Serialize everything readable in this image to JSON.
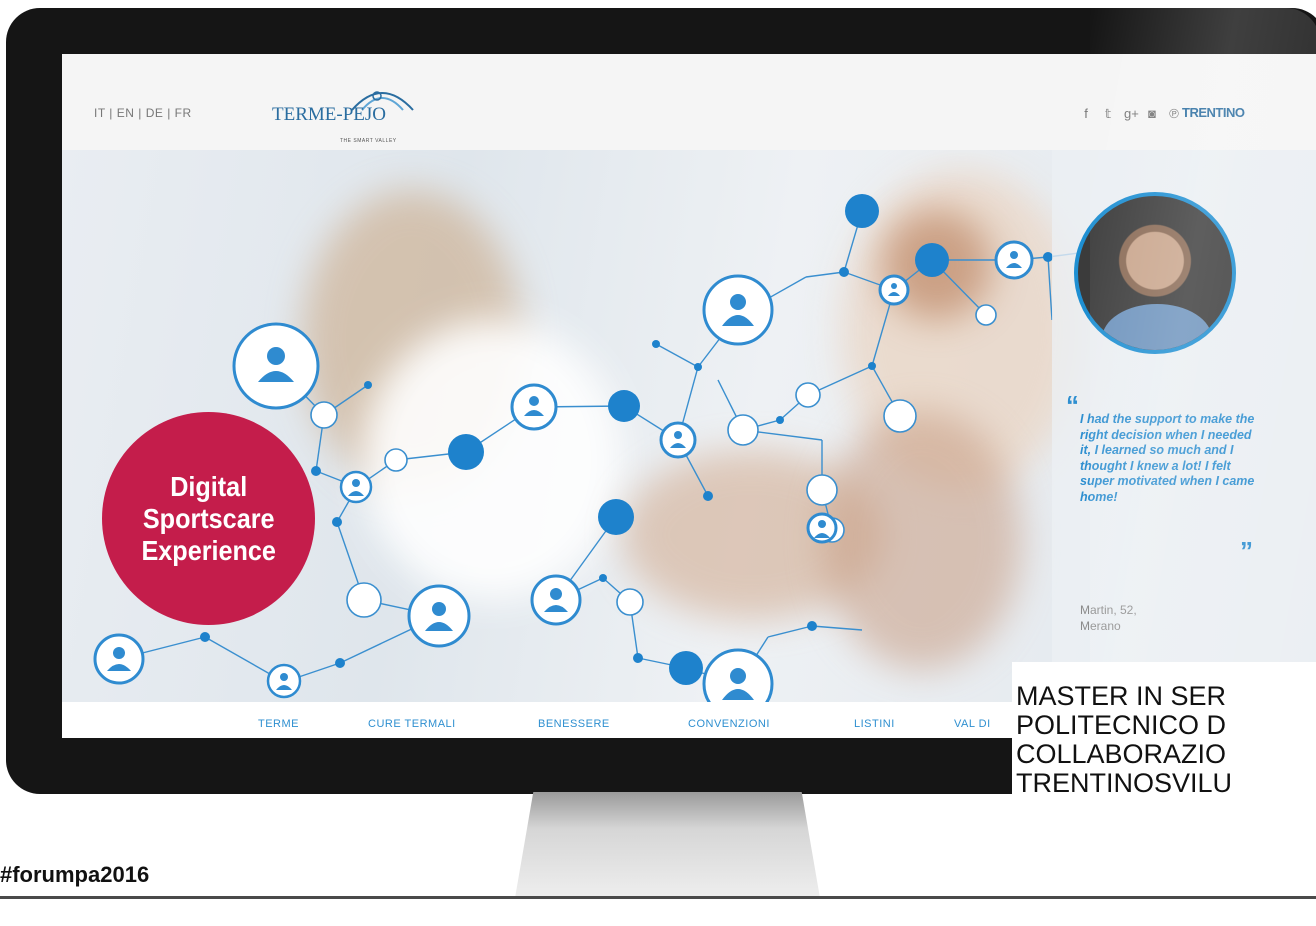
{
  "site": {
    "languages": "IT | EN | DE | FR",
    "logo_text": "TERME-PEJO",
    "logo_tagline": "THE SMART VALLEY",
    "social_icons": [
      "facebook-icon",
      "twitter-icon",
      "google-plus-icon",
      "instagram-icon",
      "pinterest-icon"
    ],
    "social_glyphs": [
      "f",
      "𝕥",
      "g+",
      "◙",
      "℗"
    ],
    "partner_logo": "TRENTINO",
    "brand_color": "#2e8fd0",
    "badge_color": "#c41d4b"
  },
  "hero": {
    "badge_lines": [
      "Digital",
      "Sportscare",
      "Experience"
    ],
    "quote": "I had the support to make the right decision when I needed it, I learned so much and I thought I knew a lot! I felt super motivated when I came home!",
    "attribution": "Martin, 52, Merano"
  },
  "nav": {
    "items": [
      "TERME",
      "CURE TERMALI",
      "BENESSERE",
      "CONVENZIONI",
      "LISTINI",
      "VAL DI"
    ]
  },
  "footer": {
    "hashtag": "#forumpa2016",
    "caption_lines": [
      "MASTER IN SER",
      "POLITECNICO D",
      "COLLABORAZIO",
      "TRENTINOSVILU"
    ]
  }
}
